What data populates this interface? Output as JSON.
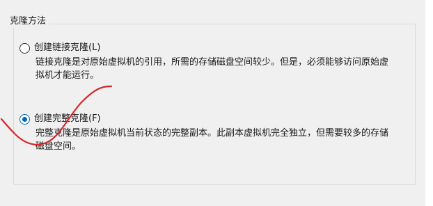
{
  "group": {
    "title": "克隆方法"
  },
  "options": {
    "linked": {
      "label": "创建链接克隆(L)",
      "description": "链接克隆是对原始虚拟机的引用，所需的存储磁盘空间较少。但是，必须能够访问原始虚拟机才能运行。",
      "selected": false
    },
    "full": {
      "label": "创建完整克隆(F)",
      "description": "完整克隆是原始虚拟机当前状态的完整副本。此副本虚拟机完全独立，但需要较多的存储磁盘空间。",
      "selected": true
    }
  },
  "annotation": {
    "color": "#d6262b"
  }
}
